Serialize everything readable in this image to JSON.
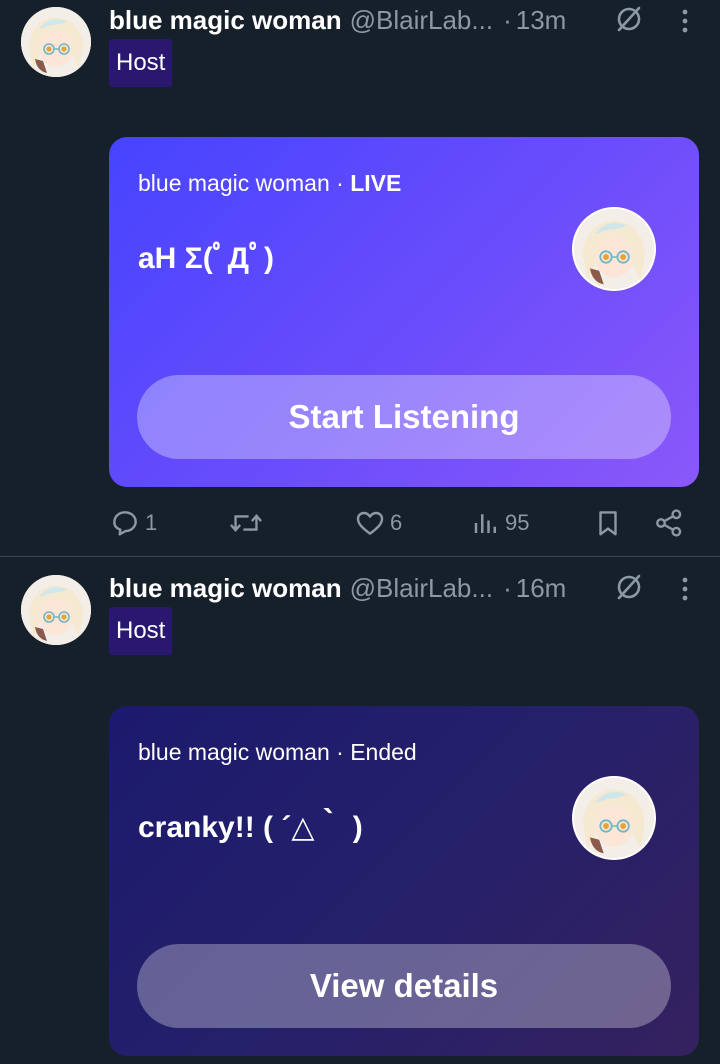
{
  "posts": [
    {
      "author": {
        "name": "blue magic woman",
        "handle": "@BlairLab...",
        "time": "13m",
        "separator": "·",
        "avatar_icon": "anime-avatar"
      },
      "badge": "Host",
      "space": {
        "host_name": "blue magic woman",
        "separator": "·",
        "status": "LIVE",
        "title": "aH Σ(ﾟДﾟ)",
        "button_label": "Start Listening"
      },
      "metrics": {
        "replies": "1",
        "reposts": "",
        "likes": "6",
        "views": "95"
      }
    },
    {
      "author": {
        "name": "blue magic woman",
        "handle": "@BlairLab...",
        "time": "16m",
        "separator": "·",
        "avatar_icon": "anime-avatar"
      },
      "badge": "Host",
      "space": {
        "host_name": "blue magic woman",
        "separator": "·",
        "status": "Ended",
        "title": "cranky!! ( ´△｀ )",
        "button_label": "View details"
      }
    }
  ],
  "colors": {
    "background": "#15202b",
    "muted_text": "#8b98a5",
    "host_badge": "#2a1770",
    "live_card_start": "#4644ff",
    "live_card_end": "#8b58fa",
    "ended_card_start": "#1c1a6e",
    "ended_card_end": "#35215f"
  }
}
